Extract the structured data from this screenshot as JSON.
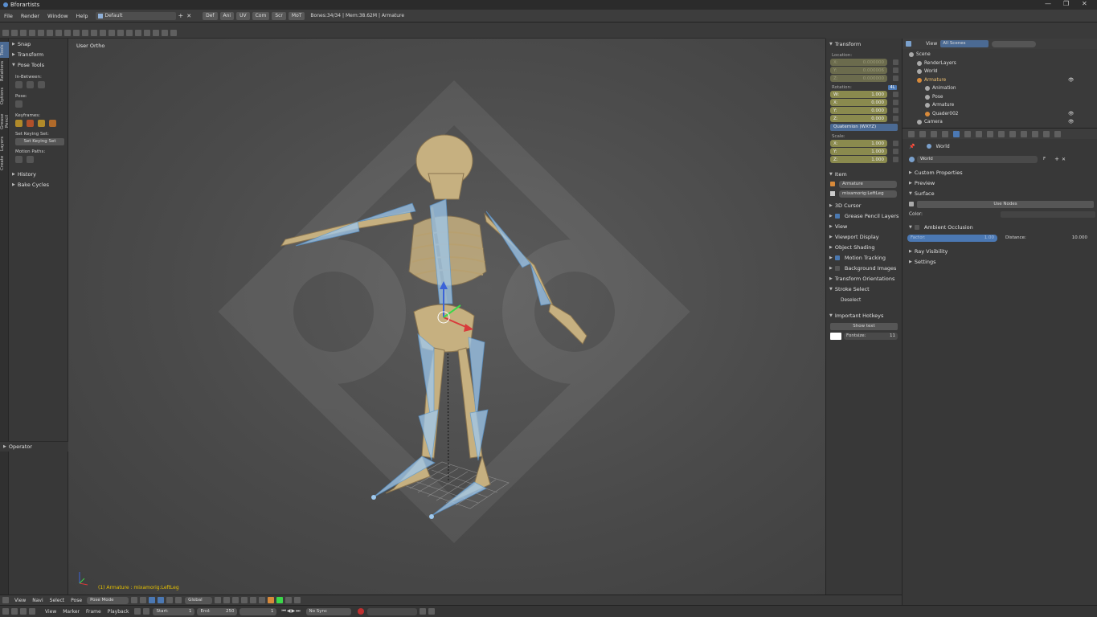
{
  "window": {
    "title": "Bforartists",
    "controls": [
      "—",
      "❐",
      "✕"
    ]
  },
  "menubar": {
    "items": [
      "File",
      "Render",
      "Window",
      "Help"
    ],
    "layout": "Default",
    "tabs": [
      "Def",
      "Ani",
      "UV",
      "Com",
      "Scr",
      "MoT"
    ],
    "stats": "Bones:34/34 | Mem:38.62M | Armature"
  },
  "left_tabs": [
    "Tools",
    "Relations",
    "Options",
    "Grease Pencil",
    "Layers",
    "Create"
  ],
  "toolshelf": {
    "snap": "Snap",
    "transform": "Transform",
    "pose_tools": "Pose Tools",
    "in_between": "In-Between:",
    "pose": "Pose:",
    "keyframes": "Keyframes:",
    "set_keying_set_label": "Set Keying Set:",
    "set_keying_set_btn": "Set Keying Set",
    "motion_paths": "Motion Paths:",
    "history": "History",
    "bake_cycles": "Bake Cycles",
    "operator": "Operator"
  },
  "viewport": {
    "view_label": "User Ortho",
    "status": "(1) Armature : mixamorig:LeftLeg"
  },
  "viewport_header": {
    "menus": [
      "View",
      "Navi",
      "Select",
      "Pose"
    ],
    "mode": "Pose Mode",
    "orientation": "Global"
  },
  "timeline": {
    "menus": [
      "View",
      "Marker",
      "Frame",
      "Playback"
    ],
    "start_label": "Start:",
    "start": "1",
    "end_label": "End:",
    "end": "250",
    "current": "1",
    "sync": "No Sync"
  },
  "npanel": {
    "transform": "Transform",
    "location": "Location:",
    "loc": [
      {
        "axis": "X:",
        "val": "0.000000"
      },
      {
        "axis": "Y:",
        "val": "0.000006"
      },
      {
        "axis": "Z:",
        "val": "0.000000"
      }
    ],
    "rotation": "Rotation:",
    "rot_toggle": "4L",
    "rot": [
      {
        "axis": "W:",
        "val": "1.000"
      },
      {
        "axis": "X:",
        "val": "0.000"
      },
      {
        "axis": "Y:",
        "val": "0.000"
      },
      {
        "axis": "Z:",
        "val": "0.000"
      }
    ],
    "rot_mode": "Quaternion (WXYZ)",
    "scale": "Scale:",
    "scl": [
      {
        "axis": "X:",
        "val": "1.000"
      },
      {
        "axis": "Y:",
        "val": "1.000"
      },
      {
        "axis": "Z:",
        "val": "1.000"
      }
    ],
    "item": "Item",
    "item_name": "Armature",
    "bone_name": "mixamorig:LeftLeg",
    "cursor3d": "3D Cursor",
    "grease_pencil": "Grease Pencil Layers",
    "view": "View",
    "viewport_display": "Viewport Display",
    "object_shading": "Object Shading",
    "motion_tracking": "Motion Tracking",
    "background_images": "Background Images",
    "transform_orient": "Transform Orientations",
    "stroke_select": "Stroke Select",
    "deselect": "Deselect",
    "important_hotkeys": "Important Hotkeys",
    "show_text": "Show text",
    "fontsize_label": "Fontsize:",
    "fontsize": "11"
  },
  "outliner": {
    "view": "View",
    "scenes": "All Scenes",
    "rows": [
      {
        "name": "Scene",
        "indent": 0
      },
      {
        "name": "RenderLayers",
        "indent": 1
      },
      {
        "name": "World",
        "indent": 1
      },
      {
        "name": "Armature",
        "indent": 1
      },
      {
        "name": "Animation",
        "indent": 2
      },
      {
        "name": "Pose",
        "indent": 2
      },
      {
        "name": "Armature",
        "indent": 2
      },
      {
        "name": "Quader002",
        "indent": 2
      },
      {
        "name": "Camera",
        "indent": 1
      }
    ]
  },
  "props": {
    "context": "World",
    "world_name": "World",
    "world_f": "F",
    "custom_props": "Custom Properties",
    "preview": "Preview",
    "surface": "Surface",
    "use_nodes": "Use Nodes",
    "color": "Color:",
    "ambient_occlusion": "Ambient Occlusion",
    "factor_label": "Factor:",
    "factor": "1.00",
    "distance_label": "Distance:",
    "distance": "10.000",
    "ray_visibility": "Ray Visibility",
    "settings": "Settings"
  }
}
